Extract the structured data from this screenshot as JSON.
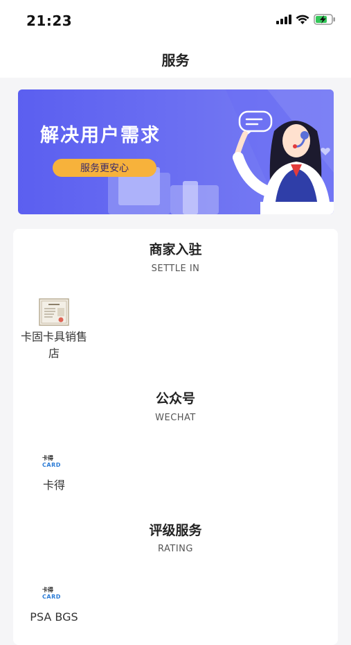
{
  "status_bar": {
    "time": "21:23"
  },
  "nav": {
    "title": "服务"
  },
  "banner": {
    "title": "解决用户需求",
    "tagline": "服务更安心"
  },
  "sections": [
    {
      "title": "商家入驻",
      "subtitle": "SETTLE IN",
      "items": [
        {
          "label_line1": "卡固卡具销售",
          "label_line2": "店",
          "icon": "certificate-thumbnail"
        }
      ]
    },
    {
      "title": "公众号",
      "subtitle": "WECHAT",
      "items": [
        {
          "label": "卡得",
          "icon": "card-logo",
          "logo_top": "卡得",
          "logo_bottom": "CARD"
        }
      ]
    },
    {
      "title": "评级服务",
      "subtitle": "RATING",
      "items": [
        {
          "label": "PSA BGS",
          "icon": "card-logo",
          "logo_top": "卡得",
          "logo_bottom": "CARD"
        }
      ]
    }
  ],
  "colors": {
    "banner_start": "#5b5ff0",
    "banner_end": "#7a80f4",
    "pill": "#f7b23b",
    "logo_blue": "#2a7bd6",
    "page_bg": "#f5f5f7"
  }
}
